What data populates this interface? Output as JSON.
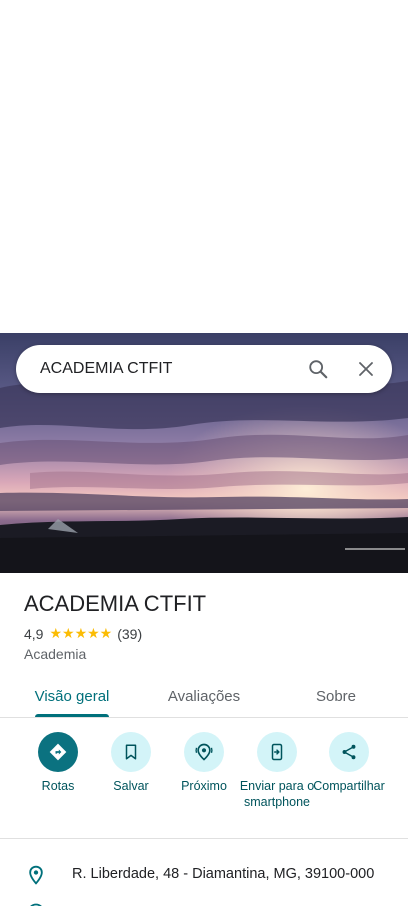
{
  "search": {
    "query": "ACADEMIA CTFIT"
  },
  "place": {
    "name": "ACADEMIA CTFIT",
    "rating": "4,9",
    "stars": "★★★★★",
    "review_count": "(39)",
    "category": "Academia"
  },
  "tabs": [
    {
      "label": "Visão geral",
      "active": true
    },
    {
      "label": "Avaliações",
      "active": false
    },
    {
      "label": "Sobre",
      "active": false
    }
  ],
  "actions": [
    {
      "label": "Rotas",
      "icon": "directions-icon"
    },
    {
      "label": "Salvar",
      "icon": "bookmark-icon"
    },
    {
      "label": "Próximo",
      "icon": "nearby-icon"
    },
    {
      "label": "Enviar para o smartphone",
      "icon": "send-to-phone-icon"
    },
    {
      "label": "Compartilhar",
      "icon": "share-icon"
    }
  ],
  "address": {
    "text": "R. Liberdade, 48 - Diamantina, MG, 39100-000"
  },
  "colors": {
    "accent": "#00707b",
    "action_bg": "#d3f4f8",
    "primary_action": "#0b7280",
    "star": "#fbbc04"
  }
}
